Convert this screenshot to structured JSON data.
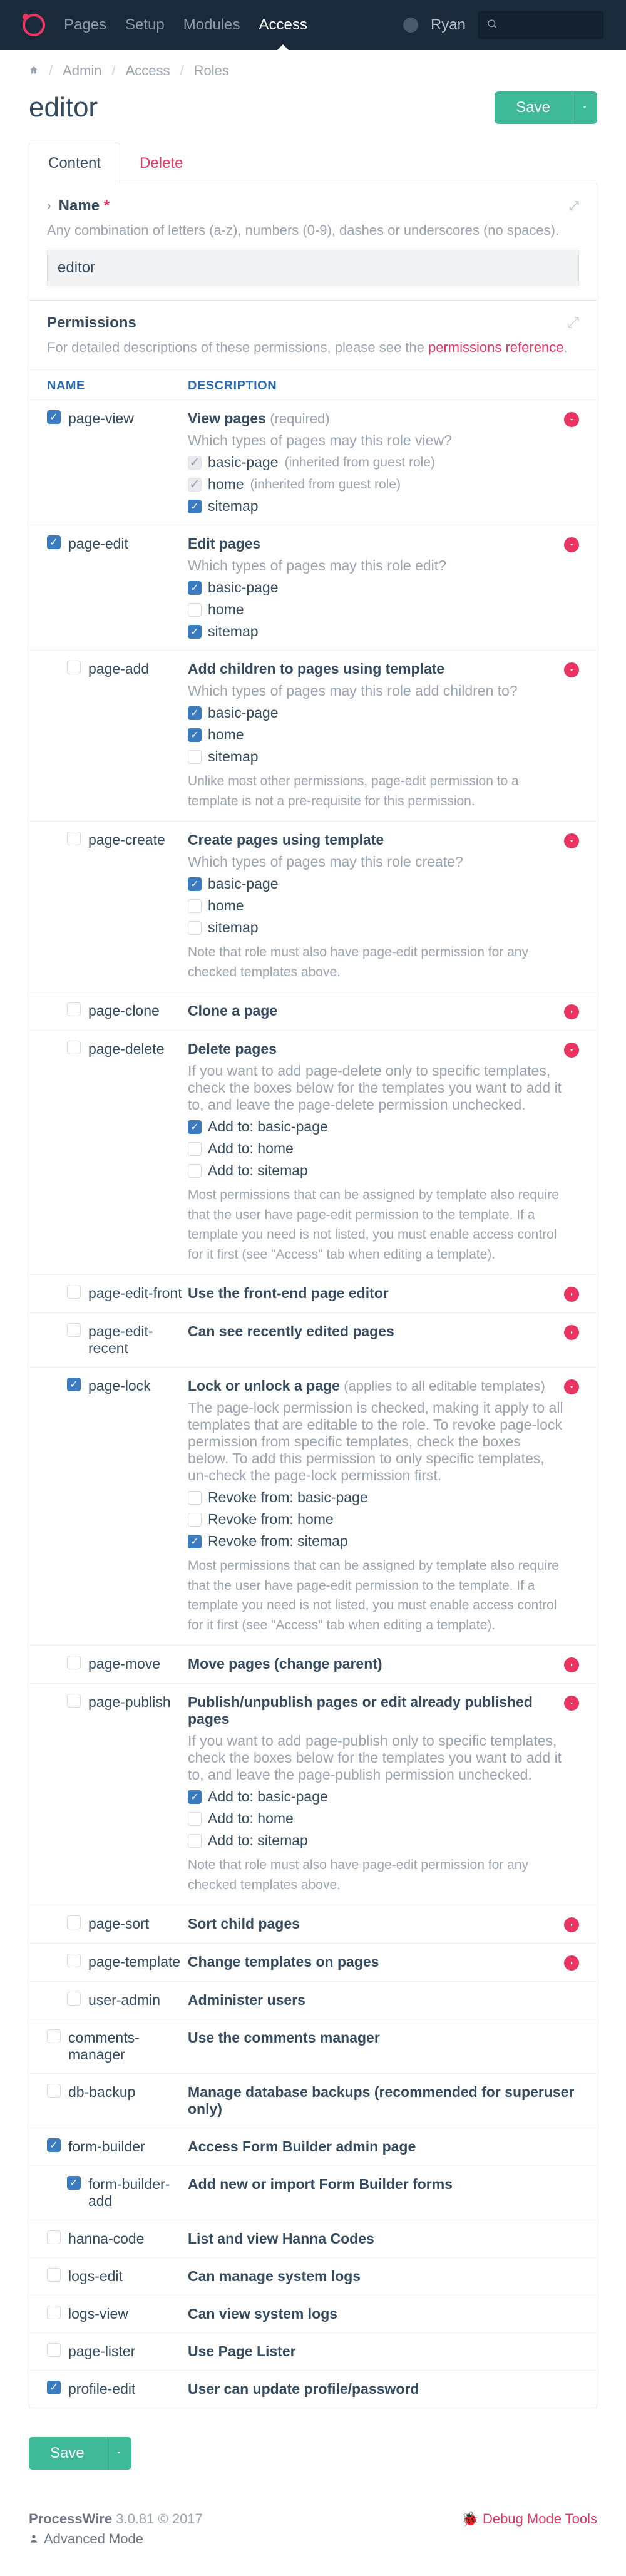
{
  "nav": {
    "pages": "Pages",
    "setup": "Setup",
    "modules": "Modules",
    "access": "Access"
  },
  "user": "Ryan",
  "breadcrumbs": [
    "Admin",
    "Access",
    "Roles"
  ],
  "pageTitle": "editor",
  "saveLabel": "Save",
  "tabs": {
    "content": "Content",
    "delete": "Delete"
  },
  "nameField": {
    "label": "Name",
    "help": "Any combination of letters (a-z), numbers (0-9), dashes or underscores (no spaces).",
    "value": "editor"
  },
  "permHeader": {
    "title": "Permissions",
    "desc": "For detailed descriptions of these permissions, please see the ",
    "linkText": "permissions reference"
  },
  "columns": {
    "name": "NAME",
    "desc": "DESCRIPTION"
  },
  "perms": {
    "view": {
      "name": "page-view",
      "title": "View pages",
      "reqLabel": "(required)",
      "q": "Which types of pages may this role view?",
      "o1": "basic-page",
      "o1inh": "(inherited from guest role)",
      "o2": "home",
      "o2inh": "(inherited from guest role)",
      "o3": "sitemap"
    },
    "edit": {
      "name": "page-edit",
      "title": "Edit pages",
      "q": "Which types of pages may this role edit?",
      "o1": "basic-page",
      "o2": "home",
      "o3": "sitemap"
    },
    "add": {
      "name": "page-add",
      "title": "Add children to pages using template",
      "q": "Which types of pages may this role add children to?",
      "o1": "basic-page",
      "o2": "home",
      "o3": "sitemap",
      "note": "Unlike most other permissions, page-edit permission to a template is not a pre-requisite for this permission."
    },
    "create": {
      "name": "page-create",
      "title": "Create pages using template",
      "q": "Which types of pages may this role create?",
      "o1": "basic-page",
      "o2": "home",
      "o3": "sitemap",
      "note": "Note that role must also have page-edit permission for any checked templates above."
    },
    "clone": {
      "name": "page-clone",
      "title": "Clone a page"
    },
    "delete": {
      "name": "page-delete",
      "title": "Delete pages",
      "q": "If you want to add page-delete only to specific templates, check the boxes below for the templates you want to add it to, and leave the page-delete permission unchecked.",
      "o1": "Add to: basic-page",
      "o2": "Add to: home",
      "o3": "Add to: sitemap",
      "note": "Most permissions that can be assigned by template also require that the user have page-edit permission to the template. If a template you need is not listed, you must enable access control for it first (see \"Access\" tab when editing a template)."
    },
    "editFront": {
      "name": "page-edit-front",
      "title": "Use the front-end page editor"
    },
    "editRecent": {
      "name": "page-edit-recent",
      "title": "Can see recently edited pages"
    },
    "lock": {
      "name": "page-lock",
      "title": "Lock or unlock a page",
      "reqLabel": "(applies to all editable templates)",
      "q": "The page-lock permission is checked, making it apply to all templates that are editable to the role. To revoke page-lock permission from specific templates, check the boxes below. To add this permission to only specific templates, un-check the page-lock permission first.",
      "o1": "Revoke from: basic-page",
      "o2": "Revoke from: home",
      "o3": "Revoke from: sitemap",
      "note": "Most permissions that can be assigned by template also require that the user have page-edit permission to the template. If a template you need is not listed, you must enable access control for it first (see \"Access\" tab when editing a template)."
    },
    "move": {
      "name": "page-move",
      "title": "Move pages (change parent)"
    },
    "publish": {
      "name": "page-publish",
      "title": "Publish/unpublish pages or edit already published pages",
      "q": "If you want to add page-publish only to specific templates, check the boxes below for the templates you want to add it to, and leave the page-publish permission unchecked.",
      "o1": "Add to: basic-page",
      "o2": "Add to: home",
      "o3": "Add to: sitemap",
      "note": "Note that role must also have page-edit permission for any checked templates above."
    },
    "sort": {
      "name": "page-sort",
      "title": "Sort child pages"
    },
    "template": {
      "name": "page-template",
      "title": "Change templates on pages"
    },
    "userAdmin": {
      "name": "user-admin",
      "title": "Administer users"
    },
    "comments": {
      "name": "comments-manager",
      "title": "Use the comments manager"
    },
    "dbBackup": {
      "name": "db-backup",
      "title": "Manage database backups (recommended for superuser only)"
    },
    "formBuilder": {
      "name": "form-builder",
      "title": "Access Form Builder admin page"
    },
    "formBuilderAdd": {
      "name": "form-builder-add",
      "title": "Add new or import Form Builder forms"
    },
    "hanna": {
      "name": "hanna-code",
      "title": "List and view Hanna Codes"
    },
    "logsEdit": {
      "name": "logs-edit",
      "title": "Can manage system logs"
    },
    "logsView": {
      "name": "logs-view",
      "title": "Can view system logs"
    },
    "lister": {
      "name": "page-lister",
      "title": "Use Page Lister"
    },
    "profile": {
      "name": "profile-edit",
      "title": "User can update profile/password"
    }
  },
  "footer": {
    "name": "ProcessWire",
    "version": "3.0.81 © 2017",
    "adv": "Advanced Mode",
    "debug": "Debug Mode Tools"
  }
}
